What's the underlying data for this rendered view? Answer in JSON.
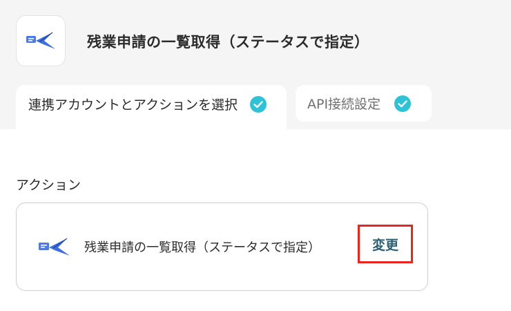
{
  "header": {
    "app_icon": "swallow-logo-icon",
    "title": "残業申請の一覧取得（ステータスで指定）"
  },
  "tabs": [
    {
      "label": "連携アカウントとアクションを選択",
      "status_icon": "check-circle-icon"
    },
    {
      "label": "API接続設定",
      "status_icon": "check-circle-icon"
    }
  ],
  "action_section": {
    "label": "アクション",
    "card": {
      "icon": "swallow-logo-icon",
      "title": "残業申請の一覧取得（ステータスで指定）",
      "change_label": "変更"
    }
  },
  "colors": {
    "check": "#2fc1d6",
    "highlight_border": "#e8261c",
    "link_text": "#2a5f73",
    "logo_blue": "#3d6fe0"
  }
}
